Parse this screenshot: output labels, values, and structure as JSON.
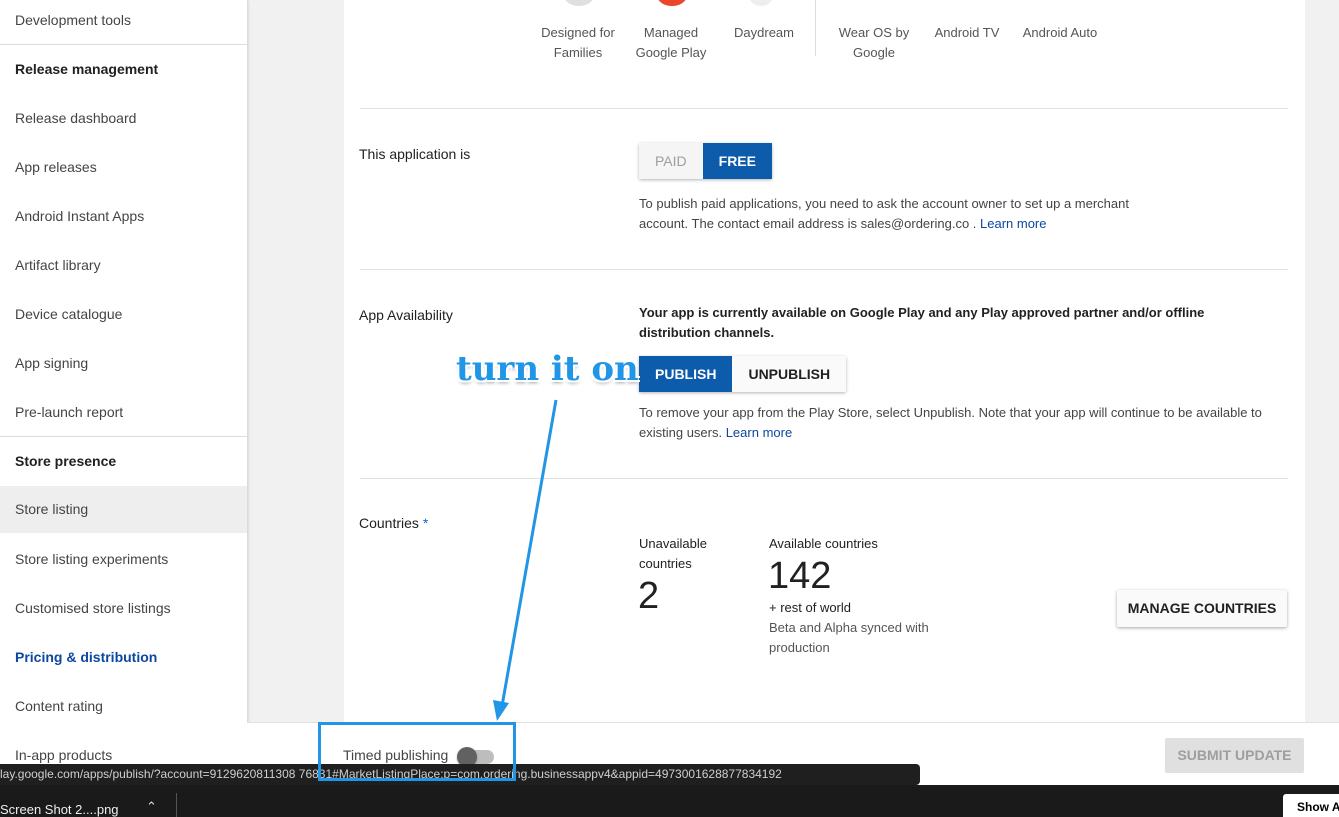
{
  "sidebar": {
    "items": [
      {
        "label": "Development tools",
        "kind": "item"
      },
      {
        "label": "Release management",
        "kind": "section"
      },
      {
        "label": "Release dashboard",
        "kind": "item"
      },
      {
        "label": "App releases",
        "kind": "item"
      },
      {
        "label": "Android Instant Apps",
        "kind": "item"
      },
      {
        "label": "Artifact library",
        "kind": "item"
      },
      {
        "label": "Device catalogue",
        "kind": "item"
      },
      {
        "label": "App signing",
        "kind": "item"
      },
      {
        "label": "Pre-launch report",
        "kind": "item"
      },
      {
        "label": "Store presence",
        "kind": "section"
      },
      {
        "label": "Store listing",
        "kind": "selected"
      },
      {
        "label": "Store listing experiments",
        "kind": "item"
      },
      {
        "label": "Customised store listings",
        "kind": "item"
      },
      {
        "label": "Pricing & distribution",
        "kind": "active"
      },
      {
        "label": "Content rating",
        "kind": "item"
      },
      {
        "label": "In-app products",
        "kind": "item"
      }
    ]
  },
  "device_categories": [
    {
      "line1": "Designed for",
      "line2": "Families"
    },
    {
      "line1": "Managed",
      "line2": "Google Play"
    },
    {
      "line1": "Daydream",
      "line2": ""
    },
    {
      "line1": "Wear OS by",
      "line2": "Google"
    },
    {
      "line1": "Android TV",
      "line2": ""
    },
    {
      "line1": "Android Auto",
      "line2": ""
    }
  ],
  "pricing": {
    "label": "This application is",
    "paid": "PAID",
    "free": "FREE",
    "help_text": "To publish paid applications, you need to ask the account owner to set up a merchant account. The contact email address is sales@ordering.co . ",
    "learn_more": "Learn more"
  },
  "availability": {
    "label": "App Availability",
    "status": "Your app is currently available on Google Play and any Play approved partner and/or offline distribution channels.",
    "publish": "PUBLISH",
    "unpublish": "UNPUBLISH",
    "help_text": "To remove your app from the Play Store, select Unpublish. Note that your app will continue to be available to existing users. ",
    "learn_more": "Learn more"
  },
  "countries": {
    "label": "Countries",
    "required_mark": "*",
    "unavailable_label_1": "Unavailable",
    "unavailable_label_2": "countries",
    "unavailable_count": "2",
    "available_label": "Available countries",
    "available_count": "142",
    "rest_of_world": "+ rest of world",
    "synced_1": "Beta and Alpha synced with",
    "synced_2": "production",
    "manage_button": "MANAGE COUNTRIES"
  },
  "bottom_bar": {
    "timed_publishing": "Timed publishing",
    "timed_publishing_on": false,
    "submit_button": "SUBMIT UPDATE"
  },
  "status_url": "lay.google.com/apps/publish/?account=9129620811308  76831#MarketListingPlace:p=com.ordering.businessappv4&appid=4973001628877834192",
  "download_shelf": {
    "file_name": "Screen Shot 2....png",
    "show_all": "Show All"
  },
  "annotation": {
    "text": "turn it on",
    "color": "#2196e6"
  }
}
